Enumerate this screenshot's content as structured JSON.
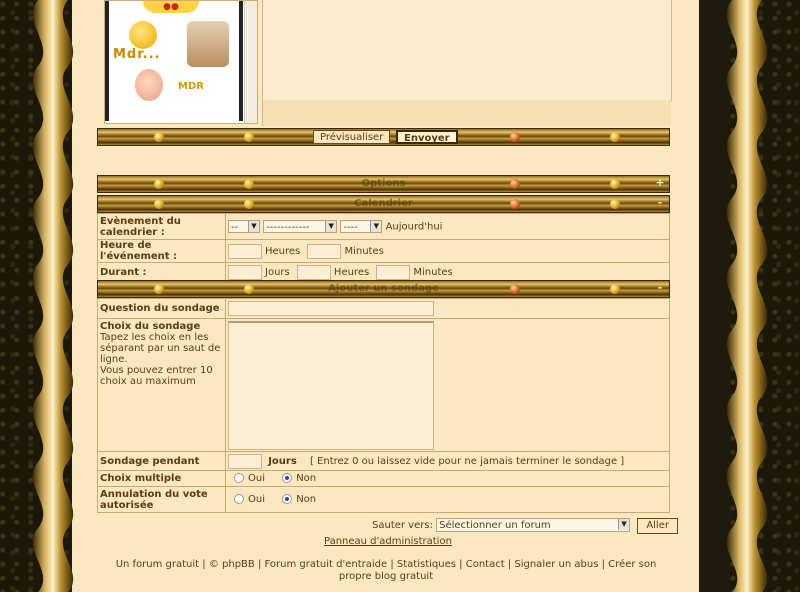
{
  "smileys": [
    "Mdr...",
    "MDR"
  ],
  "editor": {
    "preview_label": "Prévisualiser",
    "send_label": "Envoyer"
  },
  "sections": {
    "options": "Options",
    "calendar": "Calendrier",
    "poll": "Ajouter un sondage",
    "collapse_symbol": "-",
    "expand_symbol": "+"
  },
  "calendar": {
    "event_label": "Evènement du calendrier :",
    "day_value": "--",
    "month_value": "------------",
    "year_value": "----",
    "today_label": "Aujourd'hui",
    "time_label": "Heure de l'événement :",
    "hours_unit": "Heures",
    "minutes_unit": "Minutes",
    "duration_label": "Durant :",
    "days_unit": "Jours"
  },
  "poll": {
    "question_label": "Question du sondage",
    "choices_label": "Choix du sondage",
    "choices_desc": "Tapez les choix en les séparant par un saut de ligne.",
    "choices_max": "Vous pouvez entrer 10 choix au maximum",
    "length_label": "Sondage pendant",
    "length_unit": "Jours",
    "length_hint": "[ Entrez 0 ou laissez vide pour ne jamais terminer le sondage ]",
    "multiple_label": "Choix multiple",
    "cancel_label": "Annulation du vote autorisée",
    "yes": "Oui",
    "no": "Non"
  },
  "jump": {
    "label": "Sauter vers:",
    "select_value": "Sélectionner un forum",
    "go_label": "Aller"
  },
  "admin_link": "Panneau d'administration",
  "footer": {
    "free_forum": "Un forum gratuit",
    "phpbb": "© phpBB",
    "help_forum": "Forum gratuit d'entraide",
    "stats": "Statistiques",
    "contact": "Contact",
    "report": "Signaler un abus",
    "create_blog": "Créer son propre blog gratuit",
    "separator": "|"
  },
  "colors": {
    "panel": "#fbe7c0",
    "text": "#5a3d10",
    "border": "#c6aa72",
    "brass": "#c69b3c"
  }
}
